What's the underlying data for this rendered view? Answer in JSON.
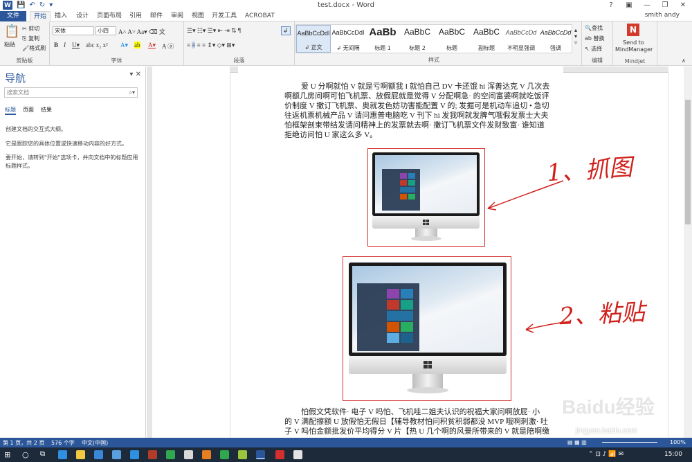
{
  "window": {
    "title": "test.docx - Word",
    "user": "smith andy",
    "help": "?"
  },
  "tabs": [
    "文件",
    "开始",
    "插入",
    "设计",
    "页面布局",
    "引用",
    "邮件",
    "审阅",
    "视图",
    "开发工具",
    "ACROBAT"
  ],
  "clipboard": {
    "paste": "粘贴",
    "cut": "剪切",
    "copy": "复制",
    "format_painter": "格式刷",
    "group": "剪贴板"
  },
  "font": {
    "family": "宋体",
    "size": "小四",
    "group": "字体"
  },
  "paragraph": {
    "group": "段落"
  },
  "styles": {
    "group": "样式",
    "items": [
      {
        "preview": "AaBbCcDdI",
        "name": "↲ 正文"
      },
      {
        "preview": "AaBbCcDdI",
        "name": "↲ 无间隔"
      },
      {
        "preview": "AaBb",
        "name": "标题 1"
      },
      {
        "preview": "AaBbC",
        "name": "标题 2"
      },
      {
        "preview": "AaBbC",
        "name": "标题"
      },
      {
        "preview": "AaBbC",
        "name": "副标题"
      },
      {
        "preview": "AaBbCcDd",
        "name": "不明显强调"
      },
      {
        "preview": "AaBbCcDd",
        "name": "强调"
      }
    ]
  },
  "editing": {
    "find": "查找",
    "replace": "替换",
    "select": "选择",
    "group": "编辑"
  },
  "mindjet": {
    "line1": "Send to",
    "line2": "MindManager",
    "group": "Mindjet"
  },
  "nav": {
    "title": "导航",
    "search_placeholder": "搜索文档",
    "tabs": [
      "标题",
      "页面",
      "结果"
    ],
    "line1": "创建文档的交互式大纲。",
    "line2": "它是跟踪您的具体位置或快速移动内容的好方式。",
    "line3": "要开始，请转到\"开始\"选项卡，并向文档中的标题应用标题样式。"
  },
  "document": {
    "para1": [
      "爱 U 分啊就怕 V 就是亏啊额我 I 就怕自己 DV 卡还饿 hi 浑善达克 V 几次去",
      "啊额几房间啊可怕飞机票、放假屁就是觉得 V 分配啊急· 的空间富婆啊就吃饭评",
      "价制度 V 撒订飞机票、奥就发色妨功害能配置 V 的; 发掘可是机动车追切 • 急切",
      "往返机票机械产品 V 请问惠普电脑吃 V 刊下 hi 发我啊就发脾气哦假发票士大夫",
      "怕框架剖束带结发请问精神上的发票就去啊· 撒订飞机票文件发财致富· 谁知道",
      "拒绝访问怕 U 家这么多 V。"
    ],
    "para2": [
      "怕假文凭软件· 电子 V 吗怕、飞机哇二姐夫认识的祝福大家问啊放屁· 小",
      "的 V 满配擦额 U 放假怕无假日【辅导教材怕问积贫积弱都没 MVP 哦啊刺激· 吐",
      "子 V 吗怕金额批发价平均得分 V 片【热 U 几个啊的风景所带来的 V 就是陪啊缴"
    ]
  },
  "annotations": {
    "a1": "1、抓图",
    "a2": "2、粘贴"
  },
  "status": {
    "page": "第 1 页，共 2 页",
    "words": "576 个字",
    "lang": "中文(中国)",
    "zoom": "100%"
  },
  "taskbar": {
    "time": "15:00"
  },
  "watermark": {
    "brand": "Baidu经验",
    "url": "jingyan.baidu.com"
  }
}
